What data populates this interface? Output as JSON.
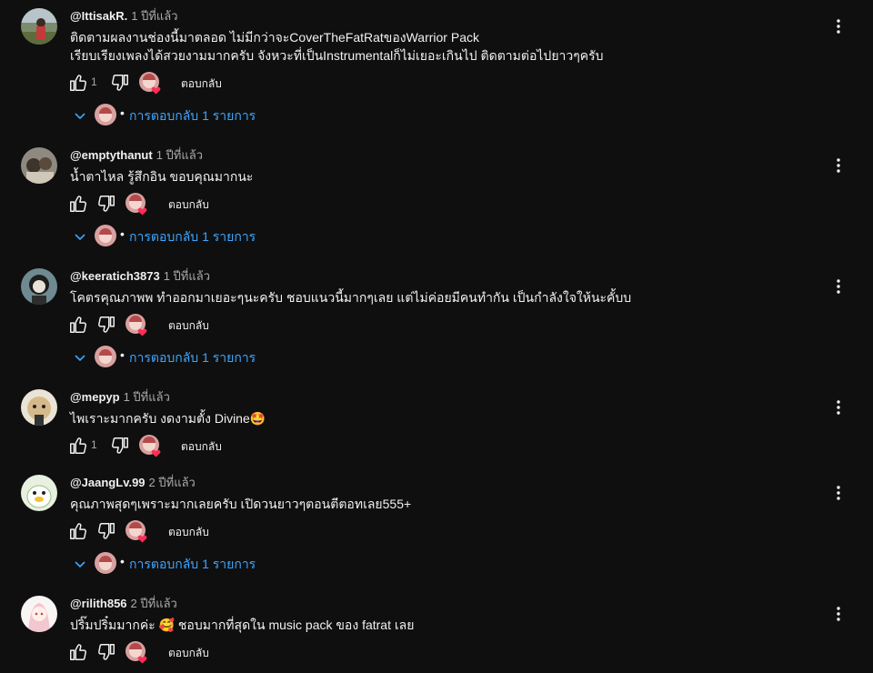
{
  "ui": {
    "reply_label": "ตอบกลับ",
    "replies_label": "การตอบกลับ 1 รายการ",
    "accent": "#3ea6ff",
    "icons": [
      "like-icon",
      "dislike-icon",
      "creator-heart-icon",
      "more-options-icon",
      "chevron-down-icon"
    ]
  },
  "comments": [
    {
      "author": "@IttisakR.",
      "time": "1 ปีที่แล้ว",
      "text": [
        "ติดตามผลงานช่องนี้มาตลอด ไม่มีกว่าจะCoverTheFatRatของWarrior Pack",
        "เรียบเรียงเพลงได้สวยงามมากครับ จังหวะที่เป็นInstrumentalก็ไม่เยอะเกินไป ติดตามต่อไปยาวๆครับ"
      ],
      "likes": "1"
    },
    {
      "author": "@emptythanut",
      "time": "1 ปีที่แล้ว",
      "text": [
        "น้ำตาไหล รู้สึกอิน ขอบคุณมากนะ"
      ],
      "likes": ""
    },
    {
      "author": "@keeratich3873",
      "time": "1 ปีที่แล้ว",
      "text": [
        "โคตรคุณภาพพ ทำออกมาเยอะๆนะครับ ชอบแนวนี้มากๆเลย แต่ไม่ค่อยมีคนทำกัน เป็นกำลังใจให้นะคั้บบ"
      ],
      "likes": ""
    },
    {
      "author": "@mepyp",
      "time": "1 ปีที่แล้ว",
      "text": [
        "ไพเราะมากครับ งดงามตั้ง Divine🤩"
      ],
      "likes": "1"
    },
    {
      "author": "@JaangLv.99",
      "time": "2 ปีที่แล้ว",
      "text": [
        "คุณภาพสุดๆเพราะมากเลยครับ เปิดวนยาวๆตอนตีตอทเลย555+"
      ],
      "likes": ""
    },
    {
      "author": "@rilith856",
      "time": "2 ปีที่แล้ว",
      "text": [
        "ปริ๊มปริ๋มมากค่ะ 🥰 ชอบมากที่สุดใน music pack ของ fatrat เลย"
      ],
      "likes": ""
    }
  ]
}
